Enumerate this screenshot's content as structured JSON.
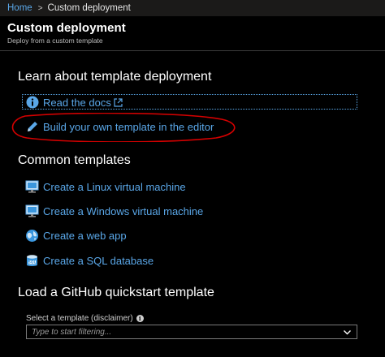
{
  "breadcrumb": {
    "home": "Home",
    "separator": ">",
    "current": "Custom deployment"
  },
  "header": {
    "title": "Custom deployment",
    "subtitle": "Deploy from a custom template"
  },
  "learn": {
    "heading": "Learn about template deployment",
    "links": [
      {
        "label": "Read the docs",
        "icon": "info-icon"
      },
      {
        "label": "Build your own template in the editor",
        "icon": "pencil-icon"
      }
    ]
  },
  "common": {
    "heading": "Common templates",
    "links": [
      {
        "label": "Create a Linux virtual machine",
        "icon": "monitor-linux-icon"
      },
      {
        "label": "Create a Windows virtual machine",
        "icon": "monitor-windows-icon"
      },
      {
        "label": "Create a web app",
        "icon": "globe-icon"
      },
      {
        "label": "Create a SQL database",
        "icon": "sql-database-icon"
      }
    ]
  },
  "github": {
    "heading": "Load a GitHub quickstart template",
    "select_label": "Select a template (disclaimer)",
    "select_placeholder": "Type to start filtering..."
  },
  "colors": {
    "link": "#5aa7e8",
    "annotation": "#d40000",
    "background": "#000000"
  }
}
